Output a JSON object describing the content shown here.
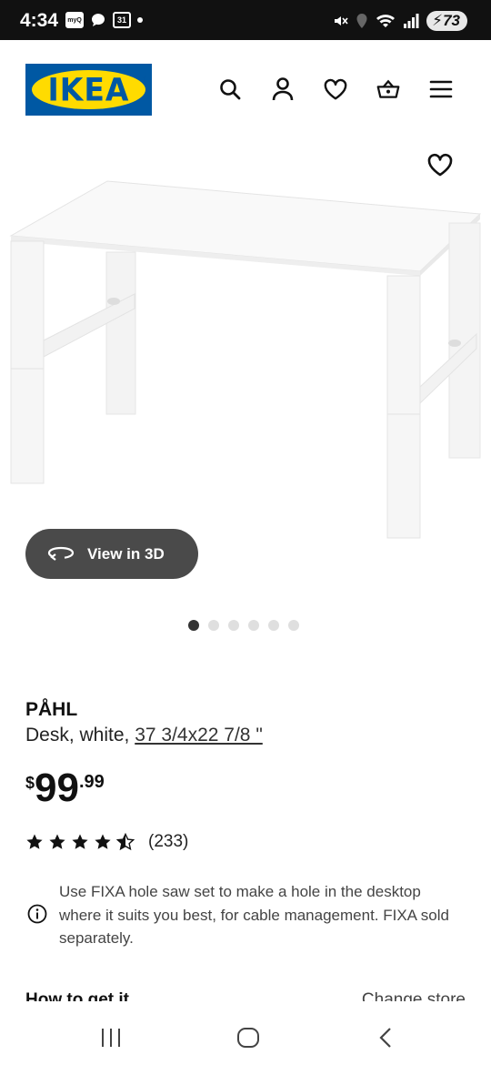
{
  "status_bar": {
    "time": "4:34",
    "icons_left": [
      "myq-app-icon",
      "chat-bubble-icon",
      "calendar-icon",
      "notification-dot"
    ],
    "calendar_day": "31",
    "myq_label": "myQ",
    "icons_right": [
      "mute-icon",
      "location-icon",
      "wifi-icon",
      "signal-icon"
    ],
    "battery": "73"
  },
  "header": {
    "logo_text": "IKEA",
    "icons": [
      "search-icon",
      "account-icon",
      "favorites-heart-icon",
      "shopping-basket-icon",
      "menu-icon"
    ]
  },
  "gallery": {
    "view_3d_label": "View in 3D",
    "dots_total": 6,
    "active_index": 0
  },
  "product": {
    "name": "PÅHL",
    "description": "Desk, white, ",
    "measurement": "37 3/4x22 7/8 \"",
    "price_currency": "$",
    "price_integer": "99",
    "price_decimal": ".99",
    "rating_value": 4.5,
    "rating_stars_max": 5,
    "review_count": "(233)",
    "notice": "Use FIXA hole saw set to make a hole in the desktop where it suits you best, for cable management. FIXA sold separately."
  },
  "fulfillment": {
    "how_to_get": "How to get it",
    "change_store": "Change store"
  },
  "colors": {
    "ikea_blue": "#0058a3",
    "ikea_yellow": "#ffdb00",
    "pill_bg": "#4a4a4a"
  }
}
